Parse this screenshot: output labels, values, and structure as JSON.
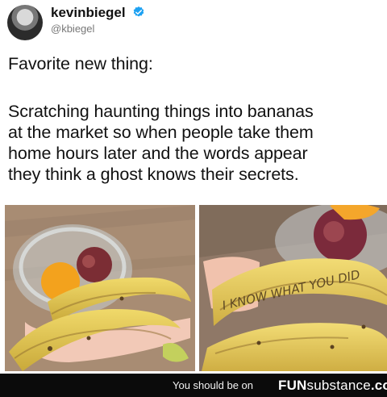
{
  "post": {
    "author_name": "kevinbiegel",
    "author_handle": "@kbiegel",
    "lines": [
      "Favorite new thing:",
      "Scratching haunting things into bananas",
      "at the market so when people take them",
      "home hours later and the words appear",
      "they think a ghost knows their secrets."
    ],
    "banana_text": "I KNOW WHAT YOU DID"
  },
  "footer": {
    "prefix": "You should be on",
    "brand_strong": "FUN",
    "brand_rest": "substance",
    "brand_suffix": ".com"
  },
  "colors": {
    "verified": "#1da1f2",
    "banana": "#e0c04b",
    "footer_bg": "#0b0b0b"
  },
  "icons": [
    "avatar",
    "verified-badge-icon"
  ]
}
